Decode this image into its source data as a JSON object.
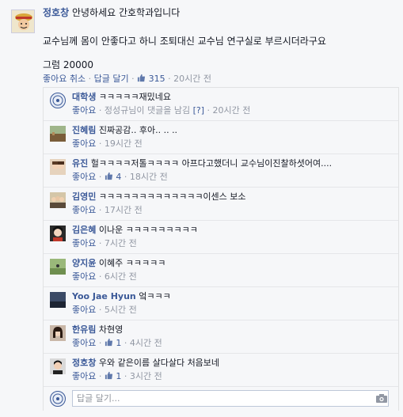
{
  "post": {
    "author": "정호창",
    "greeting": "안녕하세요 간호학과입니다",
    "body": "교수님께 몸이 안좋다고 하니 조퇴대신 교수님 연구실로 부르시더라구요",
    "ending": "그럼 20000",
    "actions": {
      "unlike": "좋아요 취소",
      "reply": "답글 달기",
      "likes": "315",
      "time": "20시간 전",
      "sep": "·"
    }
  },
  "comments": [
    {
      "name": "대학생",
      "text": "ㅋㅋㅋㅋㅋ재밌네요",
      "like": "좋아요",
      "note": "정성규님이 댓글을 남김",
      "note_q": "[?]",
      "time": "20시간 전",
      "likes": "",
      "avatar": "seal"
    },
    {
      "name": "진혜림",
      "text": "진짜공감.. 후아.. .. ..",
      "like": "좋아요",
      "note": "",
      "note_q": "",
      "time": "19시간 전",
      "likes": "",
      "avatar": "field"
    },
    {
      "name": "유진",
      "text": "헐ㅋㅋㅋㅋ저톨ㅋㅋㅋㅋ 아프다고했더니 교수님이진찰하셧어여....",
      "like": "좋아요",
      "note": "",
      "note_q": "",
      "time": "18시간 전",
      "likes": "4",
      "avatar": "girl1"
    },
    {
      "name": "김영민",
      "text": "ㅋㅋㅋㅋㅋㅋㅋㅋㅋㅋㅋㅋㅋ이센스 보소",
      "like": "좋아요",
      "note": "",
      "note_q": "",
      "time": "17시간 전",
      "likes": "",
      "avatar": "group"
    },
    {
      "name": "김은혜",
      "text": "이나운 ㅋㅋㅋㅋㅋㅋㅋㅋㅋ",
      "like": "좋아요",
      "note": "",
      "note_q": "",
      "time": "7시간 전",
      "likes": "",
      "avatar": "girl2"
    },
    {
      "name": "양지윤",
      "text": "이혜주 ㅋㅋㅋㅋㅋ",
      "like": "좋아요",
      "note": "",
      "note_q": "",
      "time": "6시간 전",
      "likes": "",
      "avatar": "green"
    },
    {
      "name": "Yoo Jae Hyun",
      "text": "엌ㅋㅋㅋ",
      "like": "좋아요",
      "note": "",
      "note_q": "",
      "time": "5시간 전",
      "likes": "",
      "avatar": "dark"
    },
    {
      "name": "한유림",
      "text": "차현영",
      "like": "좋아요",
      "note": "",
      "note_q": "",
      "time": "4시간 전",
      "likes": "1",
      "avatar": "girl3"
    },
    {
      "name": "정호창",
      "text": "우와 같은이름 살다살다 처음보네",
      "like": "좋아요",
      "note": "",
      "note_q": "",
      "time": "3시간 전",
      "likes": "1",
      "avatar": "boy"
    }
  ],
  "reply_box": {
    "placeholder": "답글 달기...",
    "camera_icon": "camera-icon"
  },
  "colors": {
    "link": "#3b5998",
    "meta": "#9197a3",
    "background": "#f6f7f9"
  }
}
